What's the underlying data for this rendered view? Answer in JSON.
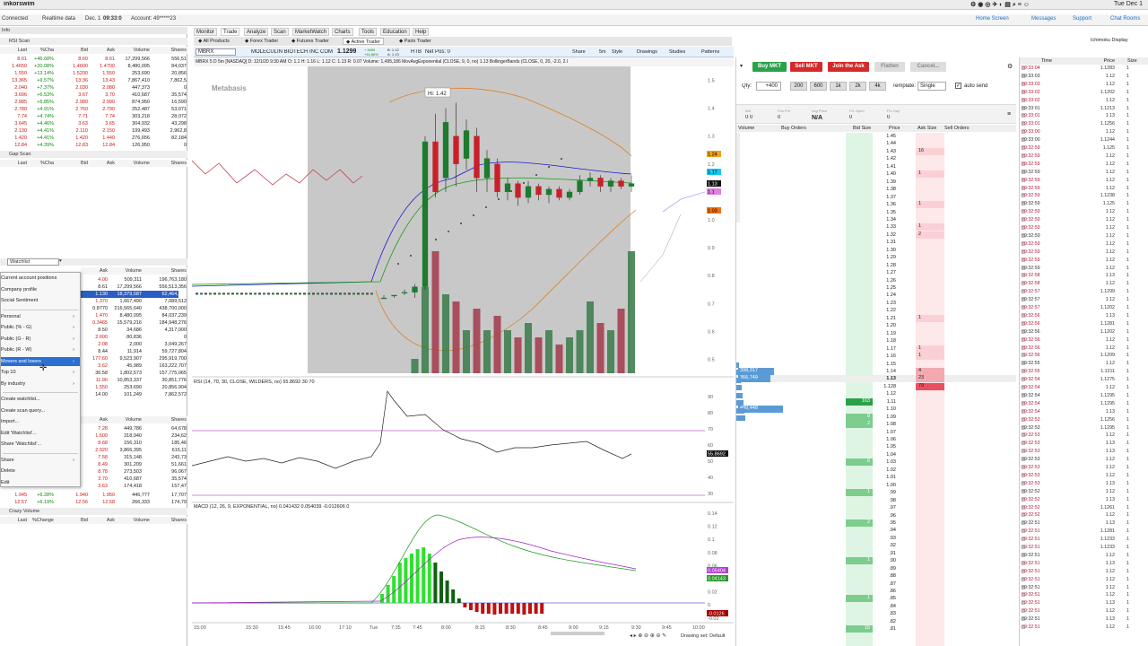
{
  "app": {
    "title": "inkorswim",
    "clock": "Tue Dec 1",
    "connected": "Connected",
    "realtime": "Realtime data",
    "date": "Dec. 1",
    "time": "09:33:0",
    "account": "Account: 49*****23"
  },
  "toplinks": {
    "home": "Home Screen",
    "messages": "Messages",
    "support": "Support",
    "chat": "Chat Rooms",
    "layout": "Ichimoku Display"
  },
  "left": {
    "section_info": "Info",
    "rsi_scan": {
      "title": "RSI Scan",
      "headers": [
        "Last",
        "%Cha",
        "Bid",
        "Ask",
        "Volume",
        "Shares"
      ],
      "rows": [
        [
          "8.61",
          "+46.68%",
          "8.60",
          "8.61",
          "17,299,566",
          "556,51"
        ],
        [
          "1.4650",
          "+20.08%",
          "1.4600",
          "1.4700",
          "8,480,095",
          "84,037"
        ],
        [
          "1.550",
          "+13.14%",
          "1.5200",
          "1.550",
          "253,690",
          "20,856"
        ],
        [
          "13.365",
          "+9.57%",
          "13.36",
          "13.43",
          "7,867,410",
          "7,862,5"
        ],
        [
          "2.040",
          "+7.37%",
          "2.030",
          "2.080",
          "447,373",
          "0"
        ],
        [
          "3.696",
          "+6.53%",
          "3.67",
          "3.70",
          "410,687",
          "35,574"
        ],
        [
          "2.985",
          "+5.85%",
          "2.980",
          "2.990",
          "874,950",
          "16,590"
        ],
        [
          "2.780",
          "+4.91%",
          "2.760",
          "2.790",
          "252,487",
          "53,071"
        ],
        [
          "7.74",
          "+4.74%",
          "7.71",
          "7.74",
          "303,218",
          "28,072"
        ],
        [
          "3.645",
          "+4.46%",
          "3.63",
          "3.65",
          "304,932",
          "43,298"
        ],
        [
          "2.130",
          "+4.41%",
          "2.110",
          "2.150",
          "199,493",
          "2,962,8"
        ],
        [
          "1.420",
          "+4.41%",
          "1.420",
          "1.440",
          "276,656",
          "82,184"
        ],
        [
          "12.84",
          "+4.39%",
          "12.83",
          "12.84",
          "126,950",
          "0"
        ]
      ]
    },
    "gap_scan": {
      "title": "Gap Scan",
      "headers": [
        "Last",
        "%Cha",
        "Bid",
        "Ask",
        "Volume",
        "Shares"
      ]
    },
    "watchlist": {
      "title": "Watchlist",
      "headers": [
        "Ask",
        "Volume",
        "Shares"
      ],
      "rows": [
        [
          "4.00",
          "509,311",
          "196,763,180"
        ],
        [
          "8.61",
          "17,299,566",
          "556,513,356"
        ],
        [
          "1.130",
          "18,379,587",
          "62,464,564"
        ],
        [
          "1.370",
          "1,667,490",
          "7,089,512"
        ],
        [
          "0.8770",
          "216,565,640",
          "438,700,000"
        ],
        [
          "1.470",
          "8,480,095",
          "84,037,239"
        ],
        [
          "0.3465",
          "15,579,216",
          "184,948,276"
        ],
        [
          "8.50",
          "34,686",
          "4,317,000"
        ],
        [
          "2.600",
          "80,836",
          "0"
        ],
        [
          "2.08",
          "2,000",
          "3,049,267"
        ],
        [
          "8.44",
          "11,914",
          "59,727,804"
        ],
        [
          "177.60",
          "9,523,907",
          "295,919,700"
        ],
        [
          "3.62",
          "45,989",
          "163,222,707"
        ],
        [
          "36.58",
          "1,802,573",
          "157,775,065"
        ],
        [
          "11.90",
          "10,853,337",
          "30,851,776"
        ],
        [
          "1.550",
          "253,690",
          "20,856,904"
        ],
        [
          "14.00",
          "101,249",
          "7,862,572"
        ]
      ]
    },
    "menu": [
      "Current account positions",
      "Company profile",
      "Social Sentiment",
      "Personal",
      "Public (% - G)",
      "Public (G - R)",
      "Public (R - W)",
      "Movers and losers",
      "Top 10",
      "By industry",
      "Create watchlist...",
      "Create scan query...",
      "Import...",
      "Edit 'Watchlist'...",
      "Share 'Watchlist'...",
      "Share",
      "Delete",
      "Edit"
    ],
    "lower": {
      "headers": [
        "Ask",
        "Volume",
        "Shares"
      ],
      "rows": [
        [
          "7.28",
          "449,786",
          "64,678"
        ],
        [
          "1.600",
          "318,940",
          "234,62"
        ],
        [
          "8.68",
          "156,310",
          "185,46"
        ],
        [
          "2.020",
          "3,866,395",
          "615,11"
        ],
        [
          "7.58",
          "315,148",
          "243,73"
        ],
        [
          "8.49",
          "301,209",
          "51,661"
        ],
        [
          "8.78",
          "273,503",
          "96,067"
        ],
        [
          "3.70",
          "410,687",
          "35,574"
        ],
        [
          "3.63",
          "174,418",
          "157,47"
        ]
      ]
    },
    "bottom_rows": [
      [
        "1.945",
        "+6.28%",
        "1.940",
        "1.950",
        "446,777",
        "17,707"
      ],
      [
        "12.57",
        "+6.19%",
        "12.56",
        "12.58",
        "266,333",
        "174,79"
      ]
    ],
    "crazy": {
      "title": "Crazy Volume",
      "headers": [
        "Last",
        "%Change",
        "Bid",
        "Ask",
        "Volume",
        "Shares"
      ]
    }
  },
  "tabs": [
    "Monitor",
    "Trade",
    "Analyze",
    "Scan",
    "MarketWatch",
    "Charts",
    "Tools",
    "Education",
    "Help"
  ],
  "subtabs": [
    "All Products",
    "Forex Trader",
    "Futures Trader",
    "Active Trader",
    "Pairs Trader"
  ],
  "symbol": {
    "ticker": "MBRX",
    "name": "MOLECULIN BIOTECH INC COM",
    "last": "1.1299",
    "chg": "+.3499",
    "pct": "+44.86%",
    "bid": "B: 1.12",
    "ask": "A: 1.13",
    "htb": "HTB",
    "netpos": "Net Pos: 0"
  },
  "chart": {
    "header": "MBRX 5 D 5m [NASDAQ]  D: 12/1/20 9:30 AM  O: 1.1  H: 1.16  L: 1.12  C: 1.13  R: 0.07  Volume: 1,495,186  MovAvgExponential (CLOSE, 9, 0, no)  1.13  BollingerBands (CLOSE, 0, 20, -2.0, 2.0, SIMPLE)",
    "toolbar": [
      "Share",
      "5m",
      "Style",
      "Drawings",
      "Studies",
      "Patterns"
    ],
    "watermark": "Metabasis",
    "hi_label": "Hi: 1.42",
    "price_ticks": [
      "1.5",
      "1.4",
      "1.3",
      "1.2",
      "1.1",
      "1.0",
      "0.9",
      "0.8",
      "0.7",
      "0.6",
      "0.5"
    ],
    "price_tags": [
      {
        "v": "1.24",
        "c": "#f0a020"
      },
      {
        "v": "1.17",
        "c": "#14c8f0"
      },
      {
        "v": "1.13",
        "c": "#111111"
      },
      {
        "v": "1.1",
        "c": "#e080e0"
      },
      {
        "v": "1.03",
        "c": "#f07010"
      }
    ],
    "rsi_header": "RSI (14, 70, 30, CLOSE, WILDERS, no)  55.8692  30  70",
    "rsi_ticks": [
      "90",
      "80",
      "70",
      "60",
      "50",
      "40",
      "30"
    ],
    "rsi_tag": "55.8692",
    "macd_header": "MACD (12, 26, 9, EXPONENTIAL, no)  0.041432  0.054039  -0.012606  0",
    "macd_ticks": [
      "0.14",
      "0.12",
      "0.1",
      "0.08",
      "0.06",
      "0.04",
      "0.02",
      "0",
      "-0.02"
    ],
    "macd_tags": [
      {
        "v": "0.05404",
        "c": "#b040d0"
      },
      {
        "v": "0.04143",
        "c": "#2a9a2a"
      },
      {
        "v": "-0.0126",
        "c": "#a00000"
      }
    ],
    "time_ticks": [
      "15:00",
      "15:30",
      "15:45",
      "16:00",
      "17:10",
      "Tue",
      "7:35",
      "7:45",
      "8:00",
      "8:15",
      "8:30",
      "8:45",
      "9:00",
      "9:15",
      "9:30",
      "9:45",
      "10:00"
    ],
    "footer": "Drawing set: Default"
  },
  "chart_data": {
    "type": "candlestick",
    "title": "MBRX 5 D 5m",
    "ylim": [
      0.45,
      1.55
    ],
    "candles": [
      [
        0.72,
        0.72,
        0.72,
        0.73
      ],
      [
        0.73,
        0.73,
        0.72,
        0.73
      ],
      [
        0.74,
        0.74,
        0.73,
        0.75
      ],
      [
        0.74,
        0.76,
        0.72,
        0.77
      ],
      [
        0.76,
        1.28,
        0.75,
        1.3
      ],
      [
        1.28,
        1.1,
        1.08,
        1.38
      ],
      [
        1.15,
        1.35,
        1.1,
        1.4
      ],
      [
        1.3,
        1.2,
        1.12,
        1.42
      ],
      [
        1.22,
        1.32,
        1.18,
        1.36
      ],
      [
        1.3,
        1.15,
        1.1,
        1.33
      ],
      [
        1.15,
        1.22,
        1.1,
        1.25
      ],
      [
        1.2,
        1.1,
        1.08,
        1.22
      ],
      [
        1.1,
        1.13,
        1.07,
        1.15
      ],
      [
        1.13,
        1.08,
        1.05,
        1.14
      ],
      [
        1.08,
        1.12,
        1.06,
        1.14
      ],
      [
        1.12,
        1.09,
        1.07,
        1.13
      ],
      [
        1.09,
        1.11,
        1.06,
        1.12
      ],
      [
        1.11,
        1.08,
        1.07,
        1.12
      ],
      [
        1.08,
        1.1,
        1.07,
        1.11
      ],
      [
        1.1,
        1.14,
        1.09,
        1.16
      ],
      [
        1.14,
        1.15,
        1.12,
        1.17
      ],
      [
        1.15,
        1.12,
        1.1,
        1.16
      ],
      [
        1.12,
        1.14,
        1.1,
        1.15
      ],
      [
        1.14,
        1.12,
        1.11,
        1.15
      ],
      [
        1.12,
        1.13,
        1.1,
        1.16
      ]
    ],
    "volume": [
      0,
      0,
      0,
      0.1,
      0.6,
      0.85,
      0.55,
      0.5,
      0.3,
      0.45,
      0.3,
      0.4,
      0.3,
      0.25,
      0.35,
      0.25,
      0.3,
      0.2,
      0.25,
      0.3,
      0.5,
      0.35,
      0.3,
      0.45,
      0.85
    ]
  },
  "order": {
    "buy_mkt": "Buy MKT",
    "sell_mkt": "Sell MKT",
    "join_ask": "Join the Ask",
    "flatten": "Flatten",
    "cancel": "Cancel...",
    "qty_label": "Qty:",
    "qty": "+400",
    "qty_btns": [
      "200",
      "600",
      "1k",
      "2k",
      "4k"
    ],
    "template_label": "Template:",
    "template": "Single",
    "autosend": "auto send",
    "pos_labels": [
      "B/A",
      "Pos Pnl",
      "Avg Price",
      "P/L Open",
      "P/L Day"
    ],
    "pos_vals": [
      "0 0",
      "0",
      "N/A",
      "0",
      "0"
    ],
    "ladder_headers": [
      "Volume",
      "Buy Orders",
      "Bid Size",
      "Price",
      "Ask Size",
      "Sell Orders"
    ],
    "prices": [
      "1.45",
      "1.44",
      "1.43",
      "1.42",
      "1.41",
      "1.40",
      "1.39",
      "1.38",
      "1.37",
      "1.36",
      "1.35",
      "1.34",
      "1.33",
      "1.32",
      "1.31",
      "1.30",
      "1.29",
      "1.28",
      "1.27",
      "1.26",
      "1.25",
      "1.24",
      "1.23",
      "1.22",
      "1.21",
      "1.20",
      "1.19",
      "1.18",
      "1.17",
      "1.16",
      "1.15",
      "1.14",
      "1.13",
      "1.128",
      "1.12",
      "1.11",
      "1.10",
      "1.09",
      "1.08",
      "1.07",
      "1.06",
      "1.05",
      "1.04",
      "1.03",
      "1.02",
      "1.01",
      "1.00",
      ".99",
      ".98",
      ".97",
      ".96",
      ".95",
      ".94",
      ".93",
      ".92",
      ".91",
      ".90",
      ".89",
      ".88",
      ".87",
      ".86",
      ".85",
      ".84",
      ".83",
      ".82",
      ".81"
    ],
    "ask_sizes": {
      "2": "16",
      "5": "1",
      "9": "1",
      "12": "1",
      "13": "2",
      "24": "1",
      "28": "1",
      "29": "1",
      "31": "4",
      "32": "23",
      "33": "79"
    },
    "bid_sizes": {
      "35": "163",
      "37": "8",
      "38": "2",
      "43": "6",
      "47": "1",
      "51": "2",
      "56": "1",
      "61": "1",
      "65": "15"
    },
    "volumes": {
      "31": "398,317",
      "32": "366,749",
      "36": "499,448"
    }
  },
  "tns": {
    "headers": [
      "Time",
      "Price",
      "Size"
    ],
    "rows": [
      [
        "09:33:04",
        "1.1283",
        "1"
      ],
      [
        "09:33:03",
        "1.12",
        "1"
      ],
      [
        "09:33:03",
        "1.12",
        "1"
      ],
      [
        "09:33:02",
        "1.1202",
        "1"
      ],
      [
        "09:33:02",
        "1.12",
        "1"
      ],
      [
        "09:33:01",
        "1.1213",
        "1"
      ],
      [
        "09:33:01",
        "1.13",
        "1"
      ],
      [
        "09:33:01",
        "1.1256",
        "1"
      ],
      [
        "09:33:00",
        "1.12",
        "1"
      ],
      [
        "09:33:00",
        "1.1244",
        "1"
      ],
      [
        "09:32:59",
        "1.125",
        "1"
      ],
      [
        "09:32:59",
        "1.12",
        "1"
      ],
      [
        "09:32:59",
        "1.12",
        "1"
      ],
      [
        "09:32:59",
        "1.12",
        "1"
      ],
      [
        "09:32:59",
        "1.12",
        "1"
      ],
      [
        "09:32:59",
        "1.12",
        "1"
      ],
      [
        "09:32:59",
        "1.1238",
        "1"
      ],
      [
        "09:32:59",
        "1.125",
        "1"
      ],
      [
        "09:32:59",
        "1.12",
        "1"
      ],
      [
        "09:32:59",
        "1.12",
        "1"
      ],
      [
        "09:32:59",
        "1.12",
        "1"
      ],
      [
        "09:32:59",
        "1.12",
        "1"
      ],
      [
        "09:32:59",
        "1.12",
        "1"
      ],
      [
        "09:32:59",
        "1.12",
        "1"
      ],
      [
        "09:32:59",
        "1.12",
        "1"
      ],
      [
        "09:32:59",
        "1.12",
        "1"
      ],
      [
        "09:32:58",
        "1.13",
        "1"
      ],
      [
        "09:32:58",
        "1.12",
        "1"
      ],
      [
        "09:32:57",
        "1.1299",
        "1"
      ],
      [
        "09:32:57",
        "1.12",
        "1"
      ],
      [
        "09:32:57",
        "1.1202",
        "1"
      ],
      [
        "09:32:56",
        "1.13",
        "1"
      ],
      [
        "09:32:56",
        "1.1281",
        "1"
      ],
      [
        "09:32:56",
        "1.1202",
        "1"
      ],
      [
        "09:32:56",
        "1.12",
        "1"
      ],
      [
        "09:32:56",
        "1.12",
        "1"
      ],
      [
        "09:32:56",
        "1.1209",
        "1"
      ],
      [
        "09:32:55",
        "1.12",
        "1"
      ],
      [
        "09:32:55",
        "1.1211",
        "1"
      ],
      [
        "09:32:54",
        "1.1275",
        "1"
      ],
      [
        "09:32:54",
        "1.12",
        "1"
      ],
      [
        "09:32:54",
        "1.1295",
        "1"
      ],
      [
        "09:32:54",
        "1.1295",
        "1"
      ],
      [
        "09:32:54",
        "1.13",
        "1"
      ],
      [
        "09:32:53",
        "1.1256",
        "1"
      ],
      [
        "09:32:53",
        "1.1295",
        "1"
      ],
      [
        "09:32:53",
        "1.12",
        "1"
      ],
      [
        "09:32:53",
        "1.13",
        "1"
      ],
      [
        "09:32:53",
        "1.13",
        "1"
      ],
      [
        "09:32:53",
        "1.12",
        "1"
      ],
      [
        "09:32:53",
        "1.12",
        "1"
      ],
      [
        "09:32:53",
        "1.12",
        "1"
      ],
      [
        "09:32:53",
        "1.13",
        "1"
      ],
      [
        "09:32:52",
        "1.12",
        "1"
      ],
      [
        "09:32:52",
        "1.13",
        "1"
      ],
      [
        "09:32:52",
        "1.1261",
        "1"
      ],
      [
        "09:32:52",
        "1.12",
        "1"
      ],
      [
        "09:32:51",
        "1.13",
        "1"
      ],
      [
        "09:32:51",
        "1.1281",
        "1"
      ],
      [
        "09:32:51",
        "1.1233",
        "1"
      ],
      [
        "09:32:51",
        "1.1233",
        "1"
      ],
      [
        "09:32:51",
        "1.12",
        "1"
      ],
      [
        "09:32:51",
        "1.13",
        "1"
      ],
      [
        "09:32:51",
        "1.12",
        "1"
      ],
      [
        "09:32:51",
        "1.12",
        "1"
      ],
      [
        "09:32:51",
        "1.12",
        "1"
      ],
      [
        "09:32:51",
        "1.12",
        "1"
      ],
      [
        "09:32:51",
        "1.13",
        "1"
      ],
      [
        "09:32:51",
        "1.12",
        "1"
      ],
      [
        "09:32:51",
        "1.13",
        "1"
      ],
      [
        "09:32:51",
        "1.12",
        "1"
      ]
    ]
  }
}
